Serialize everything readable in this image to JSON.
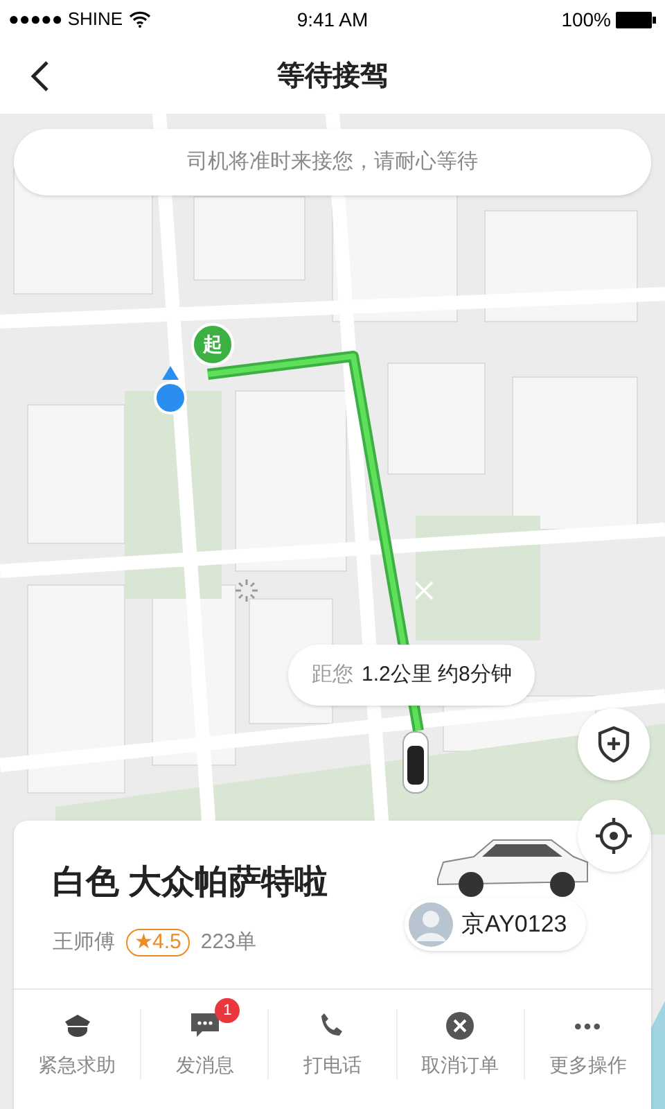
{
  "status_bar": {
    "carrier": "●●●●● SHINE",
    "time": "9:41 AM",
    "battery": "100%"
  },
  "nav": {
    "title": "等待接驾"
  },
  "notice": "司机将准时来接您，请耐心等待",
  "map": {
    "start_label": "起",
    "distance_prefix": "距您",
    "distance": "1.2公里 约8分钟"
  },
  "driver": {
    "car": "白色 大众帕萨特啦",
    "name": "王师傅",
    "rating": "★4.5",
    "orders": "223单",
    "plate": "京AY0123"
  },
  "actions": [
    {
      "kind": "police",
      "label": "紧急求助"
    },
    {
      "kind": "message",
      "label": "发消息",
      "badge": "1"
    },
    {
      "kind": "phone",
      "label": "打电话"
    },
    {
      "kind": "cancel",
      "label": "取消订单"
    },
    {
      "kind": "more",
      "label": "更多操作"
    }
  ]
}
